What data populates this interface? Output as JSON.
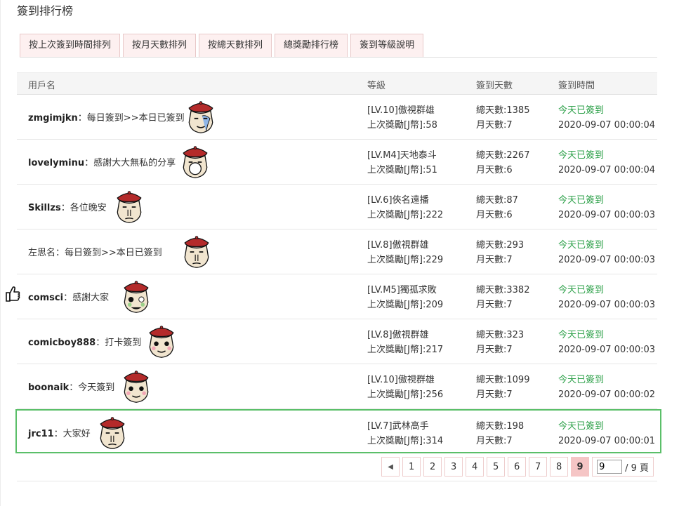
{
  "page_title": "簽到排行榜",
  "tabs": [
    {
      "label": "按上次簽到時間排列"
    },
    {
      "label": "按月天數排列"
    },
    {
      "label": "按總天數排列"
    },
    {
      "label": "總獎勵排行榜"
    },
    {
      "label": "簽到等級說明"
    }
  ],
  "columns": {
    "user": "用戶名",
    "level": "等級",
    "days": "簽到天數",
    "time": "簽到時間"
  },
  "rows": [
    {
      "name": "zmgimjkn",
      "msg": "：每日簽到>>本日已簽到",
      "level": "[LV.10]傲視群雄",
      "reward": "上次獎勵[J幣]:58",
      "total": "總天數:1385",
      "month": "月天數:7",
      "status": "今天已簽到",
      "time": "2020-09-07 00:00:04"
    },
    {
      "name": "lovelyminu",
      "msg": "：感謝大大無私的分享",
      "level": "[LV.M4]天地泰斗",
      "reward": "上次獎勵[J幣]:51",
      "total": "總天數:2267",
      "month": "月天數:6",
      "status": "今天已簽到",
      "time": "2020-09-07 00:00:04"
    },
    {
      "name": "Skillzs",
      "msg": "：各位晚安",
      "level": "[LV.6]俠名遠播",
      "reward": "上次獎勵[J幣]:222",
      "total": "總天數:87",
      "month": "月天數:6",
      "status": "今天已簽到",
      "time": "2020-09-07 00:00:03"
    },
    {
      "name": "",
      "msg": "左思名：每日簽到>>本日已簽到",
      "level": "[LV.8]傲視群雄",
      "reward": "上次獎勵[J幣]:229",
      "total": "總天數:293",
      "month": "月天數:7",
      "status": "今天已簽到",
      "time": "2020-09-07 00:00:03"
    },
    {
      "name": "comsci",
      "msg": "：感謝大家",
      "level": "[LV.M5]獨孤求敗",
      "reward": "上次獎勵[J幣]:209",
      "total": "總天數:3382",
      "month": "月天數:7",
      "status": "今天已簽到",
      "time": "2020-09-07 00:00:03"
    },
    {
      "name": "comicboy888",
      "msg": "：打卡簽到",
      "level": "[LV.8]傲視群雄",
      "reward": "上次獎勵[J幣]:217",
      "total": "總天數:323",
      "month": "月天數:7",
      "status": "今天已簽到",
      "time": "2020-09-07 00:00:03"
    },
    {
      "name": "boonaik",
      "msg": "：今天簽到",
      "level": "[LV.10]傲視群雄",
      "reward": "上次獎勵[J幣]:256",
      "total": "總天數:1099",
      "month": "月天數:7",
      "status": "今天已簽到",
      "time": "2020-09-07 00:00:02"
    },
    {
      "name": "jrc11",
      "msg": "：大家好",
      "level": "[LV.7]武林高手",
      "reward": "上次獎勵[J幣]:314",
      "total": "總天數:198",
      "month": "月天數:7",
      "status": "今天已簽到",
      "time": "2020-09-07 00:00:01"
    }
  ],
  "pagination": {
    "pages": [
      "1",
      "2",
      "3",
      "4",
      "5",
      "6",
      "7",
      "8",
      "9"
    ],
    "current": "9",
    "input_value": "9",
    "total_label": "/ 9 頁"
  },
  "colors": {
    "accent_tab_bg": "#fdf0f0",
    "status_green": "#2ea14a",
    "highlight_border": "#5bbf69",
    "active_page": "#f5c5c5"
  }
}
